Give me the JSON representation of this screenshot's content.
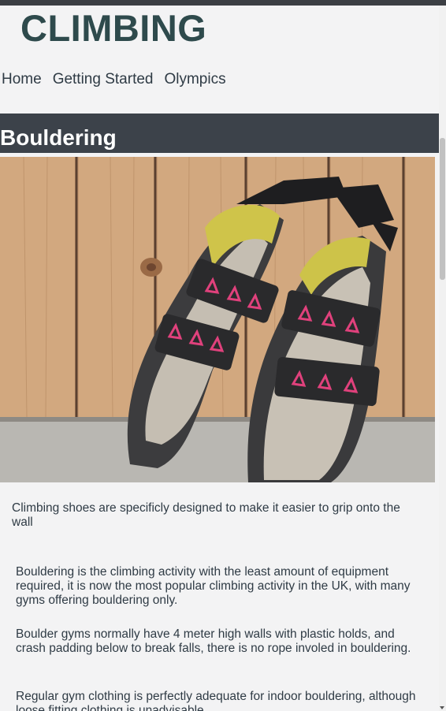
{
  "header": {
    "title": "CLIMBING",
    "nav": [
      "Home",
      "Getting Started",
      "Olympics"
    ]
  },
  "section": {
    "title": "Bouldering"
  },
  "photo": {
    "caption": "Climbing shoes are specificly designed to make it easier to grip onto the wall"
  },
  "paragraphs": [
    "Bouldering is the climbing activity with the least amount of equipment required, it is now the most popular climbing activity in the UK, with many gyms offering bouldering only.",
    "Boulder gyms normally have 4 meter high walls with plastic holds, and crash padding below to break falls, there is no rope involed in bouldering.",
    "Regular gym clothing is perfectly adequate for indoor bouldering, although loose fitting clothing is unadvisable."
  ]
}
